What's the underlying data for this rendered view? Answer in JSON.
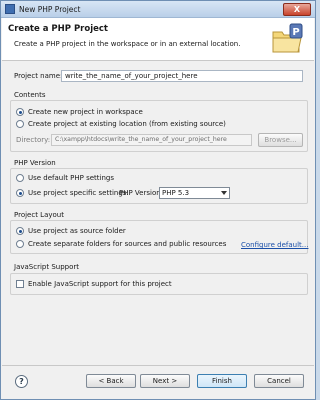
{
  "window": {
    "title": "New PHP Project",
    "close_label": "X"
  },
  "header": {
    "title": "Create a PHP Project",
    "description": "Create a PHP project in the workspace or in an external location.",
    "icon_letter": "P"
  },
  "project_name": {
    "label": "Project name:",
    "value": "write_the_name_of_your_project_here"
  },
  "contents": {
    "title": "Contents",
    "option_new": "Create new project in workspace",
    "option_existing": "Create project at existing location (from existing source)",
    "directory_label": "Directory:",
    "directory_value": "C:\\xampp\\htdocs\\write_the_name_of_your_project_here",
    "browse_label": "Browse..."
  },
  "php_version": {
    "title": "PHP Version",
    "option_default": "Use default PHP settings",
    "option_specific": "Use project specific settings:",
    "version_label": "PHP Version:",
    "version_value": "PHP 5.3"
  },
  "layout": {
    "title": "Project Layout",
    "option_source": "Use project as source folder",
    "option_separate": "Create separate folders for sources and public resources",
    "configure_link": "Configure default..."
  },
  "javascript": {
    "title": "JavaScript Support",
    "enable_label": "Enable JavaScript support for this project"
  },
  "footer": {
    "help_label": "?",
    "back_label": "< Back",
    "next_label": "Next >",
    "finish_label": "Finish",
    "cancel_label": "Cancel"
  }
}
